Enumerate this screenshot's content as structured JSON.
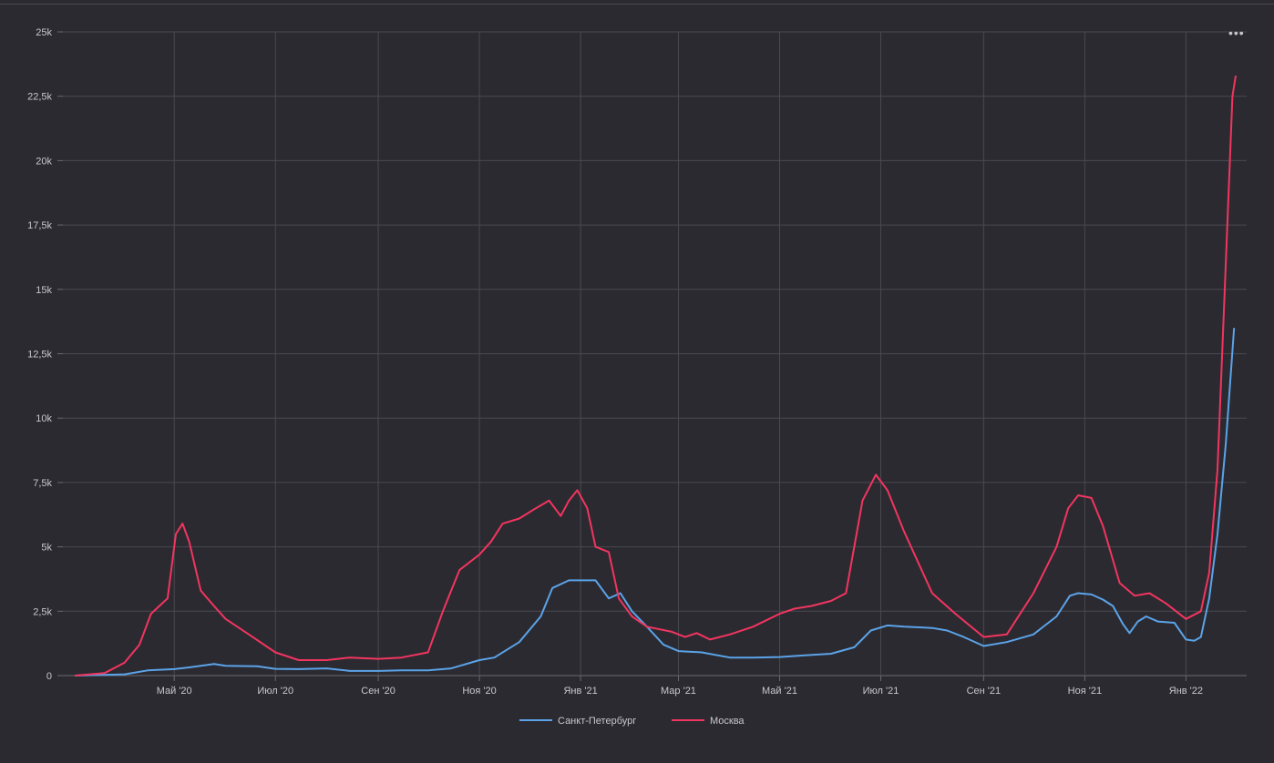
{
  "chart_data": {
    "type": "line",
    "xlabel": "",
    "ylabel": "",
    "ylim": [
      0,
      25000
    ],
    "y_ticks": [
      0,
      2500,
      5000,
      7500,
      10000,
      12500,
      15000,
      17500,
      20000,
      22500,
      25000
    ],
    "y_tick_labels": [
      "0",
      "2,5k",
      "5k",
      "7,5k",
      "10k",
      "12,5k",
      "15k",
      "17,5k",
      "20k",
      "22,5k",
      "25k"
    ],
    "x_ticks": [
      "2020-05-01",
      "2020-07-01",
      "2020-09-01",
      "2020-11-01",
      "2021-01-01",
      "2021-03-01",
      "2021-05-01",
      "2021-07-01",
      "2021-09-01",
      "2021-11-01",
      "2022-01-01"
    ],
    "x_tick_labels": [
      "Май '20",
      "Июл '20",
      "Сен '20",
      "Ноя '20",
      "Янв '21",
      "Мар '21",
      "Май '21",
      "Июл '21",
      "Сен '21",
      "Ноя '21",
      "Янв '22"
    ],
    "xlim": [
      "2020-03-02",
      "2022-01-31"
    ],
    "grid": true,
    "legend_position": "bottom",
    "series": [
      {
        "name": "Санкт-Петербург",
        "color": "#5ba3e8",
        "points": [
          [
            "2020-03-02",
            0
          ],
          [
            "2020-04-01",
            50
          ],
          [
            "2020-04-15",
            200
          ],
          [
            "2020-05-01",
            250
          ],
          [
            "2020-05-10",
            320
          ],
          [
            "2020-05-25",
            450
          ],
          [
            "2020-06-01",
            380
          ],
          [
            "2020-06-20",
            360
          ],
          [
            "2020-07-01",
            260
          ],
          [
            "2020-07-15",
            250
          ],
          [
            "2020-08-01",
            280
          ],
          [
            "2020-08-15",
            180
          ],
          [
            "2020-09-01",
            180
          ],
          [
            "2020-09-15",
            200
          ],
          [
            "2020-10-01",
            200
          ],
          [
            "2020-10-15",
            280
          ],
          [
            "2020-11-01",
            600
          ],
          [
            "2020-11-10",
            700
          ],
          [
            "2020-11-25",
            1300
          ],
          [
            "2020-12-08",
            2300
          ],
          [
            "2020-12-15",
            3400
          ],
          [
            "2020-12-25",
            3700
          ],
          [
            "2021-01-01",
            3700
          ],
          [
            "2021-01-10",
            3700
          ],
          [
            "2021-01-18",
            3000
          ],
          [
            "2021-01-25",
            3200
          ],
          [
            "2021-02-01",
            2500
          ],
          [
            "2021-02-10",
            1900
          ],
          [
            "2021-02-20",
            1200
          ],
          [
            "2021-03-01",
            950
          ],
          [
            "2021-03-15",
            900
          ],
          [
            "2021-04-01",
            700
          ],
          [
            "2021-04-15",
            700
          ],
          [
            "2021-05-01",
            720
          ],
          [
            "2021-05-15",
            780
          ],
          [
            "2021-06-01",
            850
          ],
          [
            "2021-06-15",
            1100
          ],
          [
            "2021-06-25",
            1750
          ],
          [
            "2021-07-05",
            1950
          ],
          [
            "2021-07-15",
            1900
          ],
          [
            "2021-08-01",
            1850
          ],
          [
            "2021-08-10",
            1750
          ],
          [
            "2021-08-20",
            1500
          ],
          [
            "2021-09-01",
            1150
          ],
          [
            "2021-09-15",
            1300
          ],
          [
            "2021-10-01",
            1600
          ],
          [
            "2021-10-15",
            2300
          ],
          [
            "2021-10-23",
            3100
          ],
          [
            "2021-10-28",
            3200
          ],
          [
            "2021-11-05",
            3150
          ],
          [
            "2021-11-12",
            2950
          ],
          [
            "2021-11-18",
            2700
          ],
          [
            "2021-11-24",
            2000
          ],
          [
            "2021-11-28",
            1650
          ],
          [
            "2021-12-03",
            2100
          ],
          [
            "2021-12-08",
            2300
          ],
          [
            "2021-12-15",
            2100
          ],
          [
            "2021-12-25",
            2050
          ],
          [
            "2022-01-01",
            1400
          ],
          [
            "2022-01-06",
            1350
          ],
          [
            "2022-01-10",
            1500
          ],
          [
            "2022-01-15",
            3000
          ],
          [
            "2022-01-20",
            5500
          ],
          [
            "2022-01-25",
            9000
          ],
          [
            "2022-01-30",
            13500
          ]
        ]
      },
      {
        "name": "Москва",
        "color": "#f2355f",
        "points": [
          [
            "2020-03-02",
            0
          ],
          [
            "2020-03-20",
            100
          ],
          [
            "2020-04-01",
            500
          ],
          [
            "2020-04-10",
            1200
          ],
          [
            "2020-04-17",
            2400
          ],
          [
            "2020-04-22",
            2700
          ],
          [
            "2020-04-27",
            3000
          ],
          [
            "2020-05-02",
            5500
          ],
          [
            "2020-05-06",
            5900
          ],
          [
            "2020-05-10",
            5200
          ],
          [
            "2020-05-17",
            3300
          ],
          [
            "2020-05-25",
            2700
          ],
          [
            "2020-06-01",
            2200
          ],
          [
            "2020-06-15",
            1600
          ],
          [
            "2020-07-01",
            900
          ],
          [
            "2020-07-15",
            600
          ],
          [
            "2020-08-01",
            600
          ],
          [
            "2020-08-15",
            700
          ],
          [
            "2020-09-01",
            650
          ],
          [
            "2020-09-15",
            700
          ],
          [
            "2020-10-01",
            900
          ],
          [
            "2020-10-10",
            2500
          ],
          [
            "2020-10-20",
            4100
          ],
          [
            "2020-11-01",
            4700
          ],
          [
            "2020-11-08",
            5200
          ],
          [
            "2020-11-15",
            5900
          ],
          [
            "2020-11-25",
            6100
          ],
          [
            "2020-12-05",
            6500
          ],
          [
            "2020-12-13",
            6800
          ],
          [
            "2020-12-20",
            6200
          ],
          [
            "2020-12-25",
            6800
          ],
          [
            "2020-12-30",
            7200
          ],
          [
            "2021-01-05",
            6500
          ],
          [
            "2021-01-10",
            5000
          ],
          [
            "2021-01-18",
            4800
          ],
          [
            "2021-01-24",
            3000
          ],
          [
            "2021-02-01",
            2300
          ],
          [
            "2021-02-10",
            1900
          ],
          [
            "2021-02-25",
            1700
          ],
          [
            "2021-03-05",
            1500
          ],
          [
            "2021-03-12",
            1650
          ],
          [
            "2021-03-20",
            1400
          ],
          [
            "2021-04-01",
            1600
          ],
          [
            "2021-04-15",
            1900
          ],
          [
            "2021-05-01",
            2400
          ],
          [
            "2021-05-10",
            2600
          ],
          [
            "2021-05-20",
            2700
          ],
          [
            "2021-06-01",
            2900
          ],
          [
            "2021-06-10",
            3200
          ],
          [
            "2021-06-20",
            6800
          ],
          [
            "2021-06-28",
            7800
          ],
          [
            "2021-07-05",
            7200
          ],
          [
            "2021-07-15",
            5600
          ],
          [
            "2021-08-01",
            3200
          ],
          [
            "2021-08-15",
            2400
          ],
          [
            "2021-09-01",
            1500
          ],
          [
            "2021-09-15",
            1600
          ],
          [
            "2021-10-01",
            3200
          ],
          [
            "2021-10-15",
            5000
          ],
          [
            "2021-10-22",
            6500
          ],
          [
            "2021-10-28",
            7000
          ],
          [
            "2021-11-05",
            6900
          ],
          [
            "2021-11-12",
            5800
          ],
          [
            "2021-11-22",
            3600
          ],
          [
            "2021-12-01",
            3100
          ],
          [
            "2021-12-10",
            3200
          ],
          [
            "2021-12-20",
            2800
          ],
          [
            "2022-01-01",
            2200
          ],
          [
            "2022-01-10",
            2500
          ],
          [
            "2022-01-15",
            4000
          ],
          [
            "2022-01-20",
            8000
          ],
          [
            "2022-01-25",
            16000
          ],
          [
            "2022-01-29",
            22500
          ],
          [
            "2022-01-31",
            23300
          ]
        ]
      }
    ]
  }
}
